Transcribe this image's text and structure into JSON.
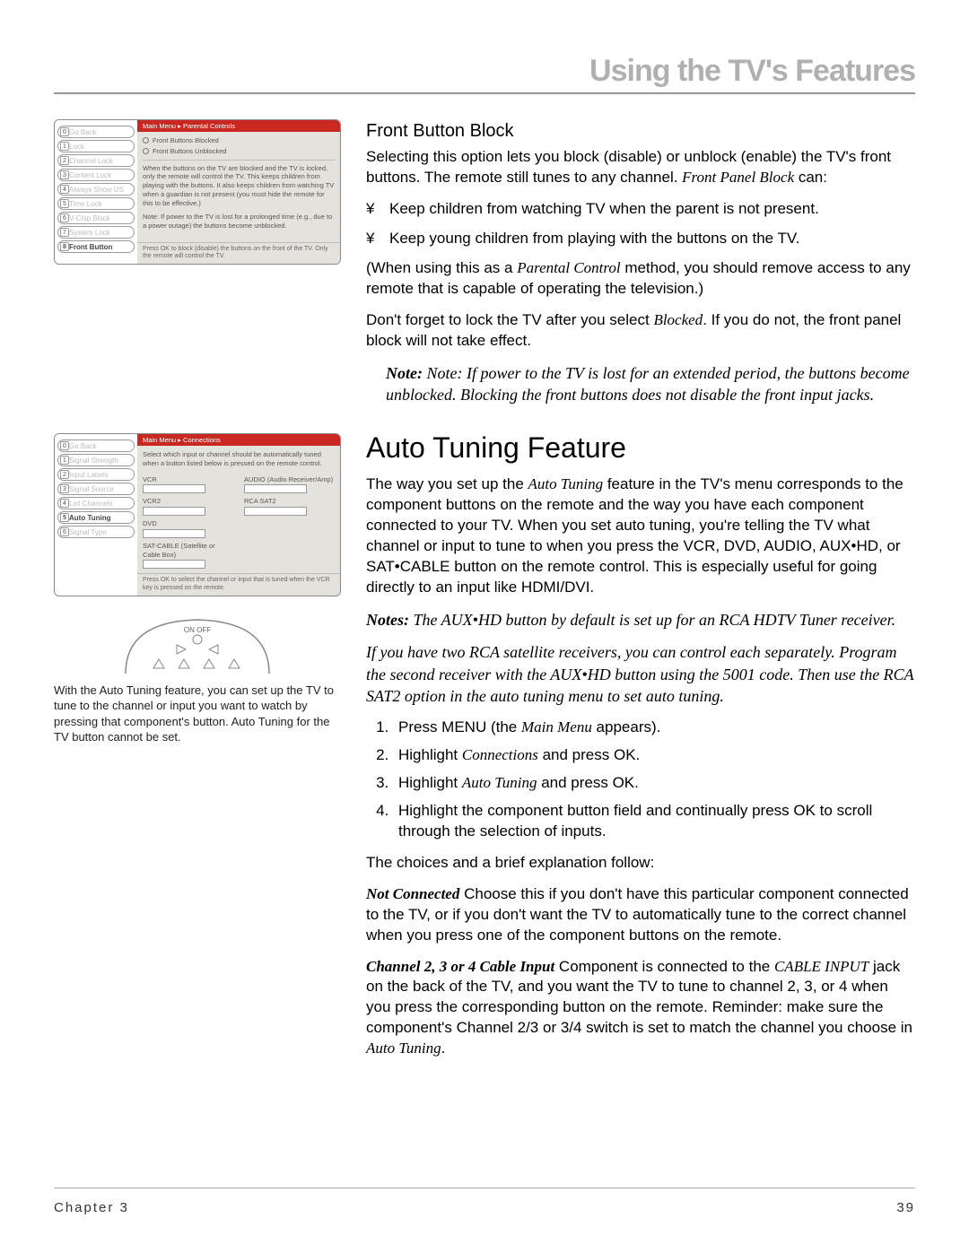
{
  "header": {
    "title": "Using the TV's Features"
  },
  "menu1": {
    "titlebar": "Main Menu ▸ Parental Controls",
    "items": [
      {
        "n": "0",
        "label": "Go Back"
      },
      {
        "n": "1",
        "label": "Lock"
      },
      {
        "n": "2",
        "label": "Channel Lock"
      },
      {
        "n": "3",
        "label": "Content Lock"
      },
      {
        "n": "4",
        "label": "Always Show US"
      },
      {
        "n": "5",
        "label": "Time Lock"
      },
      {
        "n": "6",
        "label": "V-Chip Block"
      },
      {
        "n": "7",
        "label": "System Lock"
      },
      {
        "n": "8",
        "label": "Front Button Block",
        "active": true
      }
    ],
    "radio1": "Front Buttons Blocked",
    "radio2": "Front Buttons Unblocked",
    "explain": "When the buttons on the TV are blocked and the TV is locked, only the remote will control the TV. This keeps children from playing with the buttons. It also keeps children from watching TV when a guardian is not present (you must hide the remote for this to be effective.)",
    "note": "Note: If power to the TV is lost for a prolonged time (e.g., due to a power outage) the buttons become unblocked.",
    "footer": "Press OK to block (disable) the buttons on the front of the TV. Only the remote will control the TV."
  },
  "menu2": {
    "titlebar": "Main Menu ▸ Connections",
    "items": [
      {
        "n": "0",
        "label": "Go Back"
      },
      {
        "n": "1",
        "label": "Signal Strength"
      },
      {
        "n": "2",
        "label": "Input Labels"
      },
      {
        "n": "3",
        "label": "Signal Source"
      },
      {
        "n": "4",
        "label": "List Channels"
      },
      {
        "n": "5",
        "label": "Auto Tuning",
        "active": true
      },
      {
        "n": "6",
        "label": "Signal Type"
      }
    ],
    "intro": "Select which input or channel should be automatically tuned when a button listed below is pressed on the remote control.",
    "fields_left": [
      "VCR",
      "VCR2",
      "DVD",
      "SAT-CABLE (Satellite or Cable Box)"
    ],
    "fields_right": [
      "AUDIO (Audio Receiver/Amp)",
      "RCA SAT2"
    ],
    "footer": "Press OK to select the channel or input that is tuned when the VCR key is pressed on the remote."
  },
  "remote": {
    "onoff": "ON OFF",
    "caption": "With the Auto Tuning feature, you can set up the TV to tune to the channel or input you want to watch by pressing that component's button. Auto Tuning for the TV button cannot be set."
  },
  "body": {
    "fbb_heading": "Front Button Block",
    "fbb_p1a": "Selecting this option lets you block (disable) or unblock (enable) the TV's front buttons. The remote still tunes to any channel. ",
    "fbb_p1b": "Front Panel Block",
    "fbb_p1c": " can:",
    "fbb_b1": "Keep children from watching TV when the parent is not present.",
    "fbb_b2": "Keep young children from playing with the buttons on the TV.",
    "fbb_p2a": "(When using this as a ",
    "fbb_p2b": "Parental Control",
    "fbb_p2c": " method, you should remove access to any remote that is capable of operating the television.)",
    "fbb_p3a": "Don't forget to lock the TV after you select ",
    "fbb_p3b": "Blocked",
    "fbb_p3c": ". If you do not, the front panel block will not take effect.",
    "fbb_note": "Note: If power to the TV is lost for an extended period, the buttons become unblocked. Blocking the front buttons does not disable the front input jacks.",
    "at_heading": "Auto Tuning Feature",
    "at_p1a": "The way you set up the ",
    "at_p1b": "Auto Tuning",
    "at_p1c": " feature in the TV's menu corresponds to the component buttons on the remote and the way you have each component connected to your TV. When you set auto tuning, you're telling the TV what channel or input to tune to when you press the VCR, DVD, AUDIO, AUX•HD, or SAT•CABLE button on the remote control. This is especially useful for going directly to an input like HDMI/DVI.",
    "at_note1": "Notes: The AUX•HD button by default is set up for an RCA HDTV Tuner receiver.",
    "at_note2": "If you have two RCA satellite receivers, you can control each separately. Program the second receiver with the AUX•HD button using the 5001 code. Then use the RCA SAT2 option in the auto tuning menu to set auto tuning.",
    "step1a": "Press MENU (the ",
    "step1b": "Main Menu",
    "step1c": " appears).",
    "step2a": "Highlight ",
    "step2b": "Connections",
    "step2c": " and press OK.",
    "step3a": "Highlight ",
    "step3b": "Auto Tuning",
    "step3c": " and press OK.",
    "step4": "Highlight the component button ﬁeld and continually press OK to scroll through the selection of inputs.",
    "choices_intro": "The choices and a brief explanation follow:",
    "nc_lead": "Not Connected",
    "nc_body": "   Choose this if you don't have this particular component connected to the TV, or if you don't want the TV to automatically tune to the correct channel when you press one of the component buttons on the remote.",
    "ch_lead": "Channel 2, 3 or 4 Cable Input",
    "ch_body1": "   Component is connected to the ",
    "ch_body2": "CABLE INPUT",
    "ch_body3": " jack on the back of the TV, and you want the TV to tune to channel 2, 3, or 4 when you press the corresponding button on the remote. Reminder: make sure the component's Channel 2/3 or 3/4 switch is set to match the channel you choose in ",
    "ch_body4": "Auto Tuning",
    "ch_body5": "."
  },
  "footer": {
    "left": "Chapter 3",
    "right": "39"
  }
}
